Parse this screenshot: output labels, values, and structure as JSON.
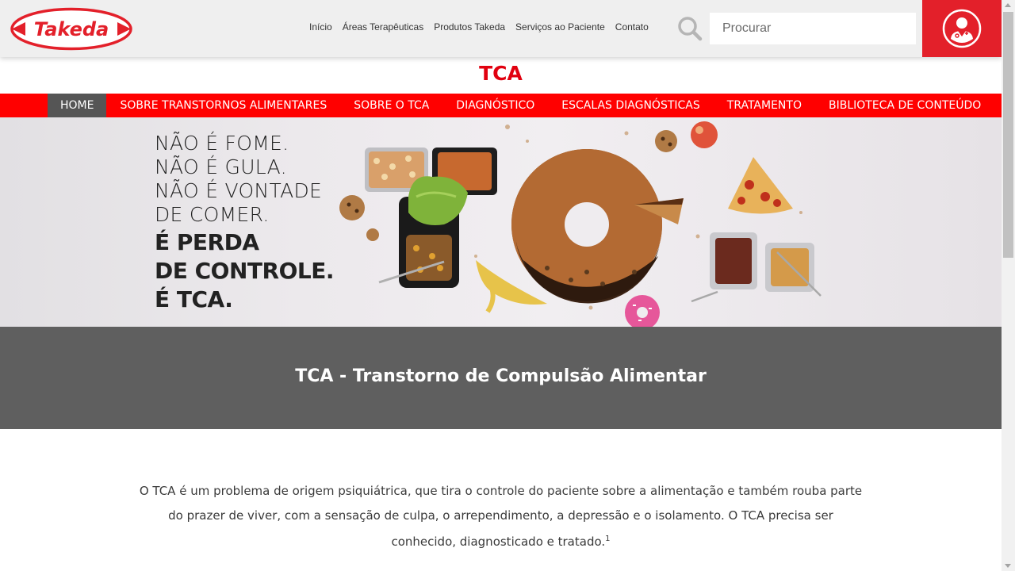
{
  "header": {
    "logo_text": "Takeda",
    "nav": [
      "Início",
      "Áreas Terapêuticas",
      "Produtos Takeda",
      "Serviços ao Paciente",
      "Contato"
    ],
    "search_placeholder": "Procurar",
    "search_icon": "search-icon",
    "user_icon": "doctor-user-icon"
  },
  "site_title": "TCA",
  "menu": {
    "items": [
      "HOME",
      "SOBRE TRANSTORNOS ALIMENTARES",
      "SOBRE O TCA",
      "DIAGNÓSTICO",
      "ESCALAS DIAGNÓSTICAS",
      "TRATAMENTO",
      "BIBLIOTECA DE CONTEÚDO"
    ],
    "active": "HOME"
  },
  "banner": {
    "lines": [
      "NÃO É FOME.",
      "NÃO É GULA.",
      "NÃO É VONTADE",
      "DE COMER."
    ],
    "bold_lines": [
      "É PERDA",
      "DE CONTROLE.",
      "É TCA."
    ]
  },
  "section": {
    "heading": "TCA - Transtorno de Compulsão Alimentar",
    "intro": "O TCA é um problema de origem psiquiátrica, que tira o controle do paciente sobre a alimentação e também rouba parte do prazer de viver, com a sensação de culpa, o arrependimento, a depressão e o isolamento. O TCA precisa ser conhecido, diagnosticado e tratado.",
    "intro_sup": "1"
  },
  "colors": {
    "brand_red": "#e3202a",
    "menu_red": "#ff0000",
    "menu_active": "#555555",
    "gray_section": "#5f5f5f"
  }
}
